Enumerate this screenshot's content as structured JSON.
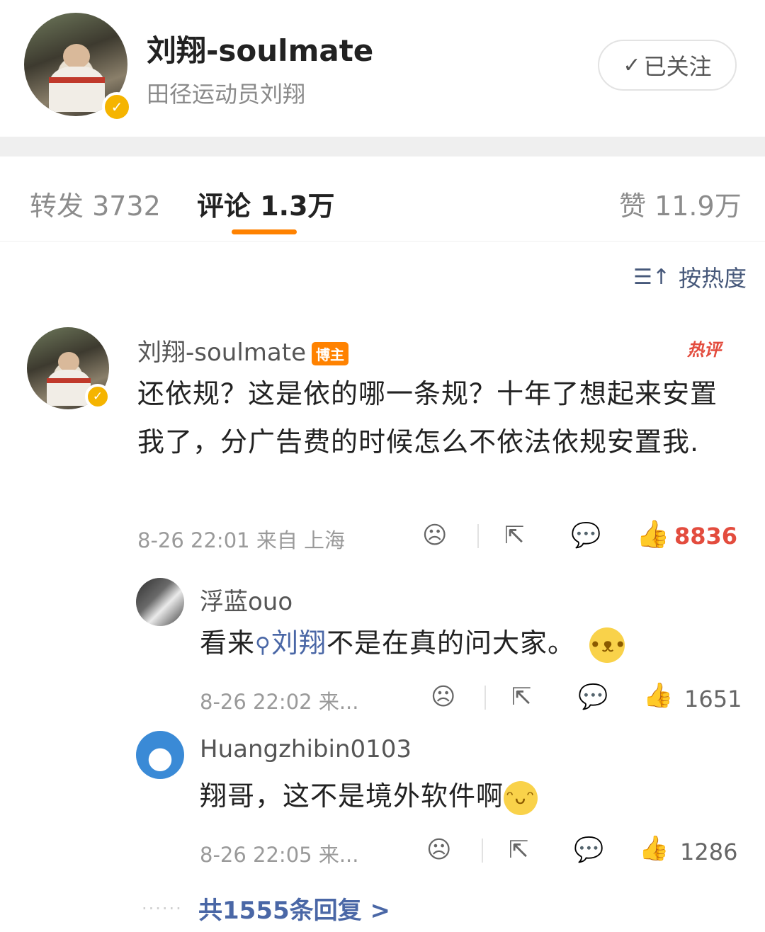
{
  "post_header": {
    "author_name": "刘翔-soulmate",
    "author_desc": "田径运动员刘翔",
    "follow_label": "已关注"
  },
  "tabs": {
    "repost": "转发 3732",
    "comments": "评论 1.3万",
    "likes": "赞 11.9万"
  },
  "sort_label": "按热度",
  "main_comment": {
    "author": "刘翔-soulmate",
    "badge": "博主",
    "hot_label": "热评",
    "text": "还依规？这是依的哪一条规？十年了想起来安置我了，分广告费的时候怎么不依法依规安置我.",
    "meta": "8-26 22:01 来自 上海",
    "likes": "8836"
  },
  "replies": [
    {
      "author": "浮蓝ouo",
      "text_before": "看来",
      "link_text": "刘翔",
      "text_after": "不是在真的问大家。",
      "meta": "8-26 22:02 来...",
      "likes": "1651"
    },
    {
      "author": "Huangzhibin0103",
      "text": "翔哥，这不是境外软件啊",
      "meta": "8-26 22:05 来...",
      "likes": "1286"
    }
  ],
  "more_replies": "共1555条回复 >",
  "dots": "......",
  "icons": {
    "check": "✓",
    "sort": "☰↑",
    "sad": "☹",
    "share": "⇱",
    "comment": "💬",
    "like": "👍",
    "search": "⚲"
  },
  "colors": {
    "accent": "#ff8200",
    "link": "#4a67a6",
    "hot": "#e34c3e",
    "verified": "#f5b400"
  }
}
